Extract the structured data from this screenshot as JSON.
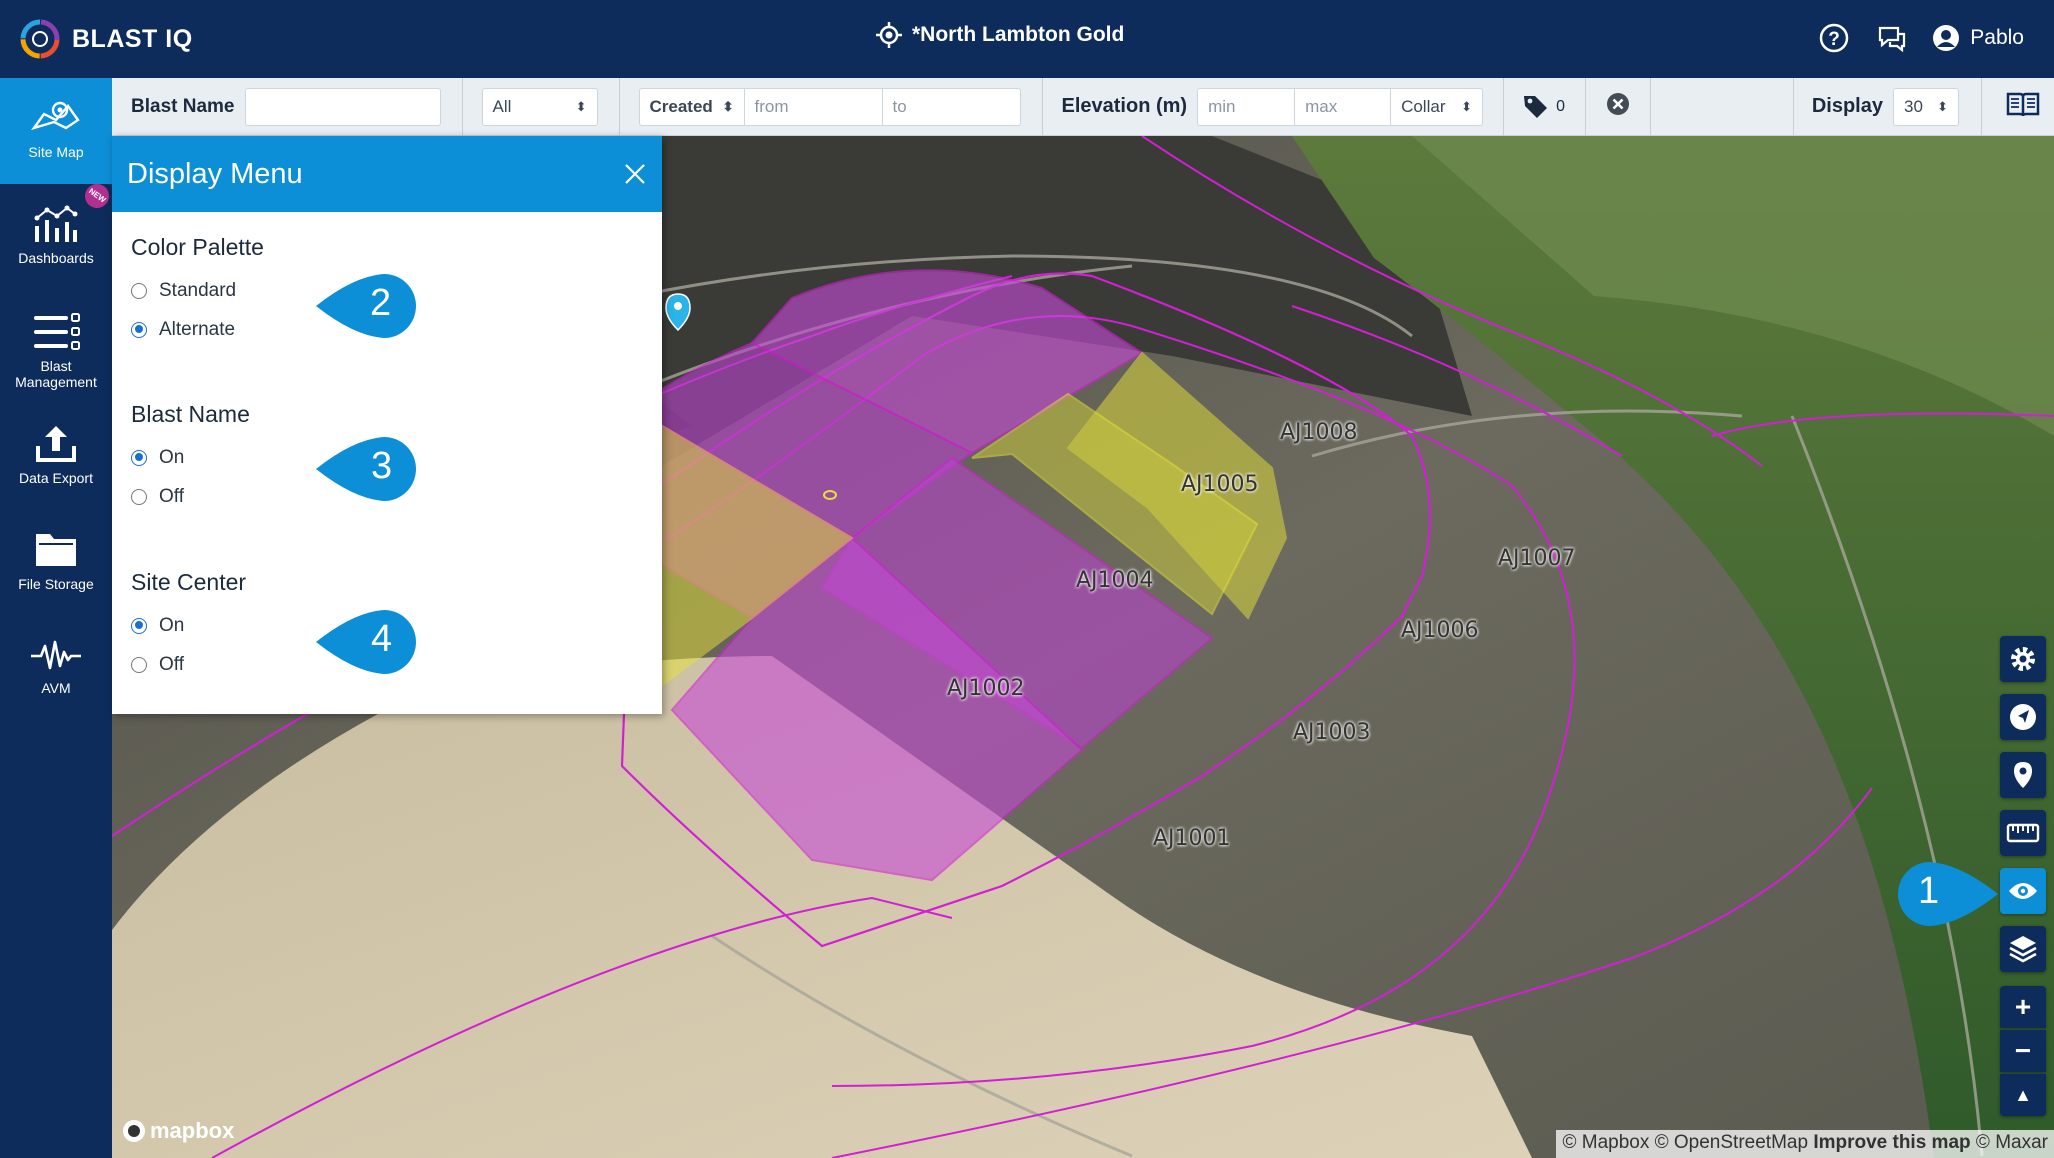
{
  "header": {
    "logo_text": "BLAST IQ",
    "site_name": "*North Lambton Gold",
    "user_name": "Pablo",
    "icons": [
      "crosshair-icon",
      "help-icon",
      "chat-support-icon",
      "user-icon"
    ]
  },
  "sidebar": {
    "items": [
      {
        "label": "Site Map",
        "icon": "map-icon",
        "active": true
      },
      {
        "label": "Dashboards",
        "icon": "dashboard-chart-icon",
        "badge": "NEW"
      },
      {
        "label": "Blast Management",
        "icon": "list-icon"
      },
      {
        "label": "Data Export",
        "icon": "upload-icon"
      },
      {
        "label": "File Storage",
        "icon": "folder-icon"
      },
      {
        "label": "AVM",
        "icon": "waveform-icon"
      }
    ]
  },
  "filters": {
    "blast_name_label": "Blast Name",
    "blast_name_value": "",
    "status_select": "All",
    "created_select": "Created",
    "from_placeholder": "from",
    "to_placeholder": "to",
    "elevation_label": "Elevation (m)",
    "min_placeholder": "min",
    "max_placeholder": "max",
    "collar_select": "Collar",
    "tag_count": "0",
    "display_label": "Display",
    "display_select": "30"
  },
  "display_menu": {
    "title": "Display Menu",
    "sections": [
      {
        "heading": "Color Palette",
        "options": [
          {
            "label": "Standard",
            "selected": false
          },
          {
            "label": "Alternate",
            "selected": true
          }
        ]
      },
      {
        "heading": "Blast Name",
        "options": [
          {
            "label": "On",
            "selected": true
          },
          {
            "label": "Off",
            "selected": false
          }
        ]
      },
      {
        "heading": "Site Center",
        "options": [
          {
            "label": "On",
            "selected": true
          },
          {
            "label": "Off",
            "selected": false
          }
        ]
      }
    ]
  },
  "callouts": [
    "1",
    "2",
    "3",
    "4"
  ],
  "map": {
    "blasts": [
      "AJ1001",
      "AJ1002",
      "AJ1003",
      "AJ1004",
      "AJ1005",
      "AJ1006",
      "AJ1007",
      "AJ1008"
    ],
    "colors": {
      "purple": "#c64bd6",
      "yellow": "#e6e33a",
      "boundary": "#d21fd6"
    },
    "controls": [
      "gear-icon",
      "navigate-icon",
      "pin-icon",
      "ruler-icon",
      "eye-icon",
      "layers-icon",
      "zoom-in",
      "zoom-out",
      "compass-icon"
    ],
    "zoom_in_label": "+",
    "zoom_out_label": "−",
    "compass_label": "▲",
    "mapbox_logo": "mapbox",
    "attribution_prefix": "© Mapbox © OpenStreetMap",
    "attribution_improve": "Improve this map",
    "attribution_suffix": "© Maxar"
  }
}
